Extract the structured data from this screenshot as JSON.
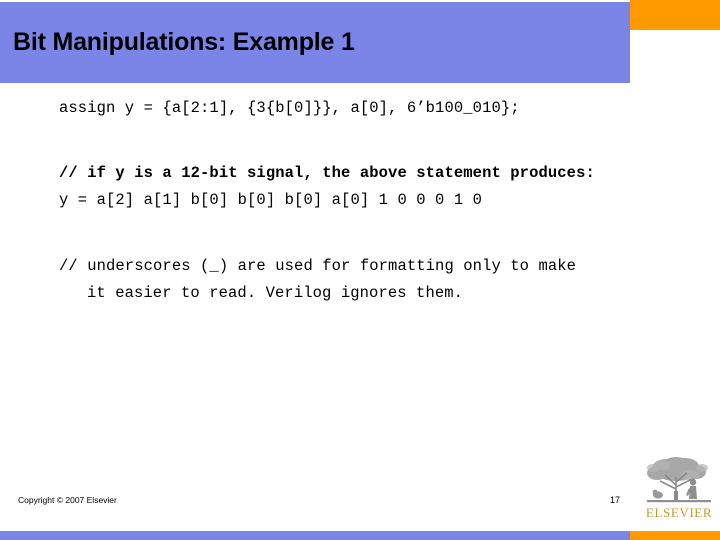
{
  "slide": {
    "title": "Bit Manipulations: Example 1",
    "code_lines": [
      "assign y = {a[2:1], {3{b[0]}}, a[0], 6’b100_010};",
      "// if y is a 12-bit signal, the above statement produces:",
      "y = a[2] a[1] b[0] b[0] b[0] a[0] 1 0 0 0 1 0",
      "// underscores (_) are used for formatting only to make",
      "it easier to read. Verilog ignores them."
    ],
    "footer": {
      "copyright": "Copyright © 2007 Elsevier",
      "page_number": "17",
      "logo_wordmark": "ELSEVIER"
    },
    "colors": {
      "title_band": "#7b85e8",
      "accent_orange": "#ff9900",
      "logo_gold": "#c8992f",
      "text": "#000000",
      "background": "#ffffff"
    }
  }
}
